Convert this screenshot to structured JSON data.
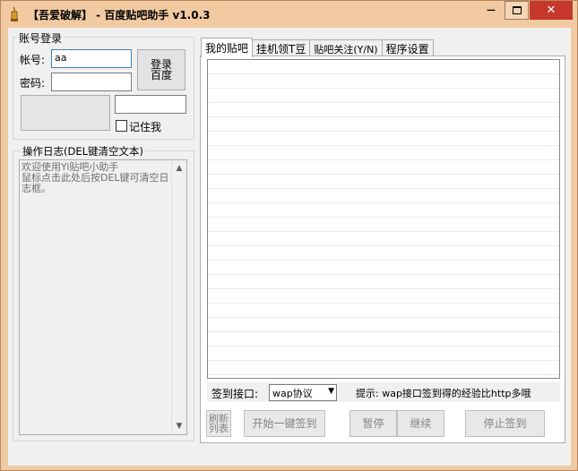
{
  "window": {
    "title": "【吾爱破解】 - 百度贴吧助手 v1.0.3",
    "minimize_glyph": "—",
    "close_glyph": "✕"
  },
  "login": {
    "group_title": "账号登录",
    "account_label": "帐号:",
    "account_value": "aa",
    "password_label": "密码:",
    "password_value": "",
    "login_button": "登录\n百度",
    "remember_label": "记住我",
    "remember_checked": false
  },
  "log": {
    "group_title": "操作日志(DEL键清空文本)",
    "text": "欢迎使用Yi贴吧小助手\n鼠标点击此处后按DEL键可清空日志框。",
    "scroll_up": "▲",
    "scroll_down": "▼"
  },
  "tabs": [
    {
      "label": "我的贴吧",
      "active": true
    },
    {
      "label": "挂机领T豆",
      "active": false
    },
    {
      "label": "贴吧关注(Y/N)",
      "active": false
    },
    {
      "label": "程序设置",
      "active": false
    }
  ],
  "signin": {
    "interface_label": "签到接口:",
    "interface_value": "wap协议",
    "hint": "提示: wap接口签到得的经验比http多哦"
  },
  "buttons": {
    "refresh": "刷新\n列表",
    "one_click": "开始一键签到",
    "pause": "暂停",
    "resume": "继续",
    "stop": "停止签到"
  }
}
